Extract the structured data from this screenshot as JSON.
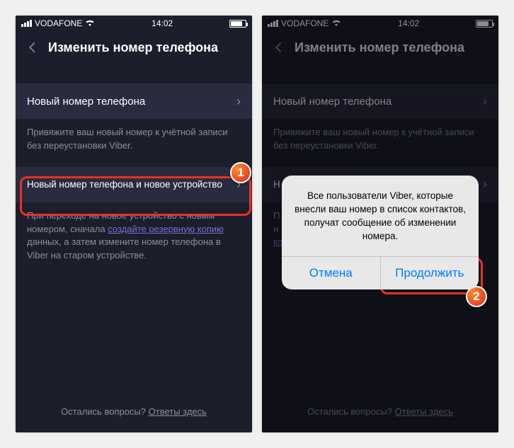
{
  "status": {
    "carrier": "VODAFONE",
    "time": "14:02"
  },
  "header": {
    "title": "Изменить номер телефона"
  },
  "option1": {
    "title": "Новый номер телефона",
    "desc": "Привяжите ваш новый номер к учётной записи без переустановки Viber."
  },
  "option2": {
    "title": "Новый номер телефона и новое устройство",
    "desc_pre": "При переходе на новое устройство с новым номером, сначала ",
    "desc_link": "создайте резервную копию",
    "desc_post": " данных, а затем измените номер телефона в Viber на старом устройстве."
  },
  "footer": {
    "text_pre": "Остались вопросы? ",
    "link": "Ответы здесь"
  },
  "alert": {
    "message": "Все пользователи Viber, которые внесли ваш номер в список контактов, получат сообщение об изменении номера.",
    "cancel": "Отмена",
    "continue": "Продолжить"
  },
  "badges": {
    "one": "1",
    "two": "2"
  }
}
